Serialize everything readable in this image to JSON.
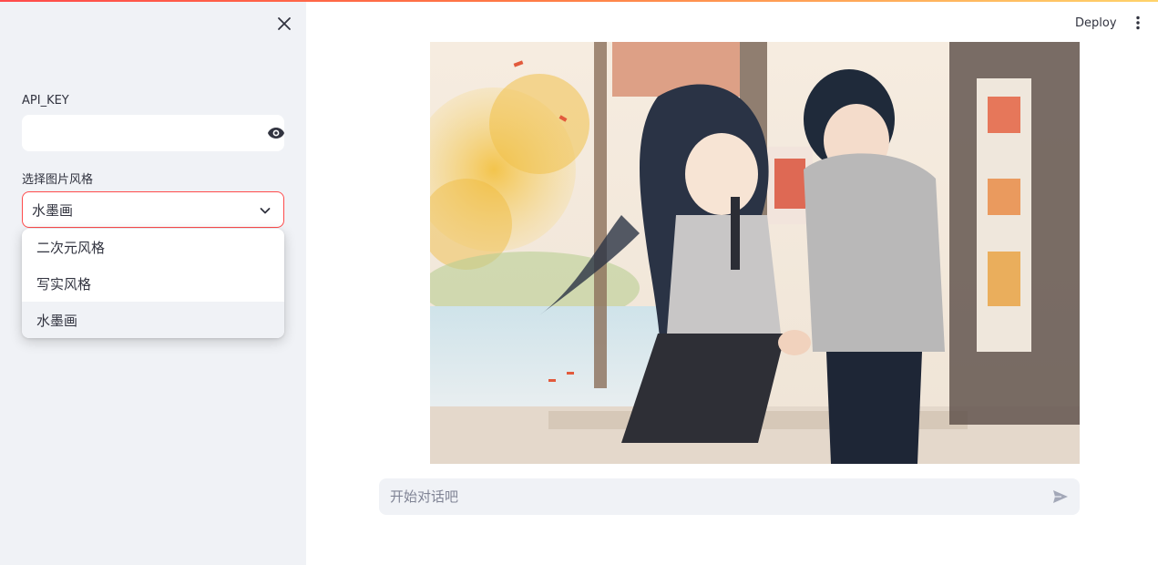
{
  "header": {
    "deploy_label": "Deploy",
    "menu_icon": "vertical-dots-icon"
  },
  "sidebar": {
    "close_icon": "close-icon",
    "api_key": {
      "label": "API_KEY",
      "value": "",
      "toggle_icon": "eye-icon"
    },
    "style_select": {
      "label": "选择图片风格",
      "selected": "水墨画",
      "options": [
        "二次元风格",
        "写实风格",
        "水墨画"
      ],
      "selected_index": 2
    }
  },
  "main": {
    "image_description_icon": "generated-image",
    "chat_input": {
      "placeholder": "开始对话吧",
      "value": "",
      "send_icon": "send-icon"
    }
  },
  "colors": {
    "accent": "#ff4b4b",
    "sidebar_bg": "#f0f2f6",
    "text": "#31333f"
  }
}
